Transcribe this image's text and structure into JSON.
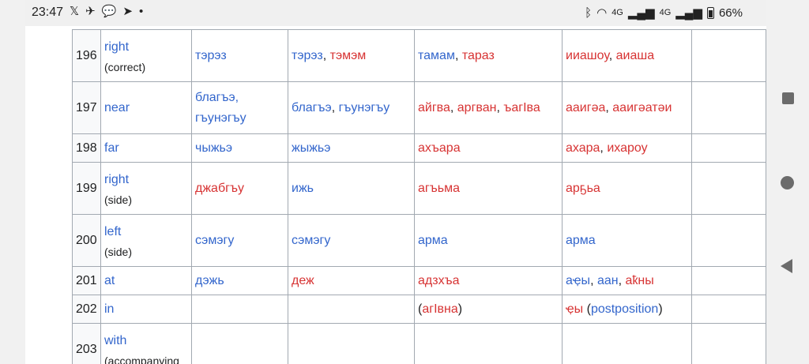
{
  "status_bar": {
    "time": "23:47",
    "left_icons": [
      "x-app-icon",
      "telegram-icon",
      "chat-icon",
      "send-icon",
      "dot-icon"
    ],
    "network_1": "4G",
    "network_2": "4G",
    "battery": "66%"
  },
  "rows": [
    {
      "num": "196",
      "english": "right",
      "note": "(correct)",
      "c1": [
        {
          "t": "тэрэз",
          "c": "blue"
        }
      ],
      "c2": [
        {
          "t": "тэрэз",
          "c": "blue"
        },
        {
          "t": ", ",
          "c": "dark"
        },
        {
          "t": "тэмэм",
          "c": "red"
        }
      ],
      "c3": [
        {
          "t": "тамам",
          "c": "blue"
        },
        {
          "t": ", ",
          "c": "dark"
        },
        {
          "t": "тараз",
          "c": "red"
        }
      ],
      "c4": [
        {
          "t": "ииашоу",
          "c": "red"
        },
        {
          "t": ", ",
          "c": "dark"
        },
        {
          "t": "аиаша",
          "c": "red"
        }
      ]
    },
    {
      "num": "197",
      "english": "near",
      "note": "",
      "c1": [
        {
          "t": "благъэ,",
          "c": "blue"
        },
        {
          "t": "гъунэгъу",
          "c": "blue",
          "br": true
        }
      ],
      "c2": [
        {
          "t": "благъэ",
          "c": "blue"
        },
        {
          "t": ", ",
          "c": "dark"
        },
        {
          "t": "гъунэгъу",
          "c": "blue"
        }
      ],
      "c3": [
        {
          "t": "айгва",
          "c": "red"
        },
        {
          "t": ", ",
          "c": "dark"
        },
        {
          "t": "аргван",
          "c": "red"
        },
        {
          "t": ", ",
          "c": "dark"
        },
        {
          "t": "ъагӀва",
          "c": "red"
        }
      ],
      "c4": [
        {
          "t": "аaигәа",
          "c": "red"
        },
        {
          "t": ", ",
          "c": "dark"
        },
        {
          "t": "аaигәатәи",
          "c": "red"
        }
      ]
    },
    {
      "num": "198",
      "english": "far",
      "note": "",
      "c1": [
        {
          "t": "чыжьэ",
          "c": "blue"
        }
      ],
      "c2": [
        {
          "t": "жыжьэ",
          "c": "blue"
        }
      ],
      "c3": [
        {
          "t": "ахъара",
          "c": "red"
        }
      ],
      "c4": [
        {
          "t": "ахара",
          "c": "red"
        },
        {
          "t": ", ",
          "c": "dark"
        },
        {
          "t": "ихароу",
          "c": "red"
        }
      ]
    },
    {
      "num": "199",
      "english": "right",
      "note": "(side)",
      "c1": [
        {
          "t": "джабгъу",
          "c": "red"
        }
      ],
      "c2": [
        {
          "t": "ижь",
          "c": "blue"
        }
      ],
      "c3": [
        {
          "t": "агъьма",
          "c": "red"
        }
      ],
      "c4": [
        {
          "t": "арҕьа",
          "c": "red"
        }
      ]
    },
    {
      "num": "200",
      "english": "left",
      "note": "(side)",
      "c1": [
        {
          "t": "сэмэгу",
          "c": "blue"
        }
      ],
      "c2": [
        {
          "t": "сэмэгу",
          "c": "blue"
        }
      ],
      "c3": [
        {
          "t": "арма",
          "c": "blue"
        }
      ],
      "c4": [
        {
          "t": "арма",
          "c": "blue"
        }
      ]
    },
    {
      "num": "201",
      "english": "at",
      "note": "",
      "c1": [
        {
          "t": "дэжь",
          "c": "blue"
        }
      ],
      "c2": [
        {
          "t": "деж",
          "c": "red"
        }
      ],
      "c3": [
        {
          "t": "адзхъа",
          "c": "red"
        }
      ],
      "c4": [
        {
          "t": "аҿы",
          "c": "blue"
        },
        {
          "t": ", ",
          "c": "dark"
        },
        {
          "t": "аан",
          "c": "blue"
        },
        {
          "t": ", ",
          "c": "dark"
        },
        {
          "t": "аҟны",
          "c": "red"
        }
      ]
    },
    {
      "num": "202",
      "english": "in",
      "note": "",
      "c1": [],
      "c2": [],
      "c3": [
        {
          "t": "(",
          "c": "dark"
        },
        {
          "t": "агӀвна",
          "c": "red"
        },
        {
          "t": ")",
          "c": "dark"
        }
      ],
      "c4": [
        {
          "t": "ҿы",
          "c": "red"
        },
        {
          "t": " (",
          "c": "dark"
        },
        {
          "t": "postposition",
          "c": "blue"
        },
        {
          "t": ")",
          "c": "dark"
        }
      ]
    },
    {
      "num": "203",
      "english": "with",
      "note": "(accompanying",
      "c1": [],
      "c2": [],
      "c3": [],
      "c4": []
    }
  ]
}
